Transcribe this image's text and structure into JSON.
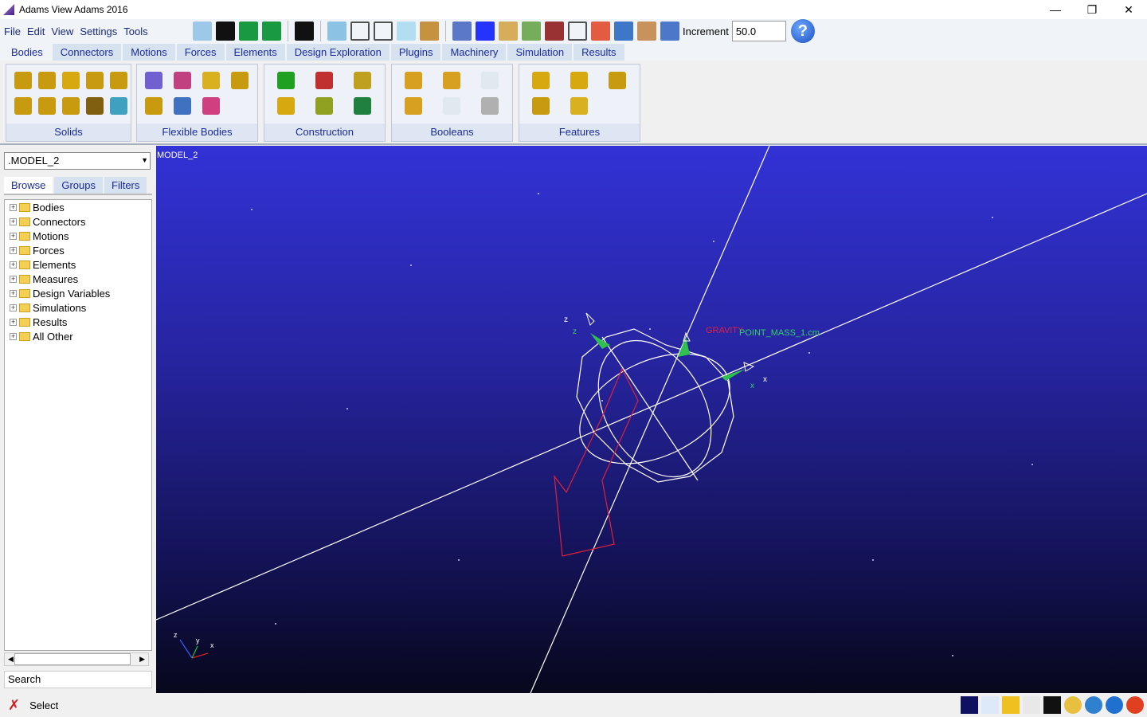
{
  "window": {
    "title": "Adams View Adams 2016",
    "min": "—",
    "max": "❐",
    "close": "✕"
  },
  "menu": [
    "File",
    "Edit",
    "View",
    "Settings",
    "Tools"
  ],
  "toolbar": {
    "increment_label": "Increment",
    "increment_value": "50.0",
    "help": "?",
    "icons": [
      "new-model-icon",
      "save-icon",
      "redo-icon",
      "undo-icon",
      "select-arrow-icon",
      "render-shaded-icon",
      "render-wireframe-icon",
      "render-hidden-icon",
      "iso-view-icon",
      "triad-icon",
      "grid-icon",
      "color-icon",
      "zoom-window-icon",
      "fit-icon",
      "fit-all-icon",
      "zoom-box-icon",
      "center-icon",
      "translate-icon",
      "pan-hand-icon",
      "zoom-icon"
    ]
  },
  "tabs": [
    "Bodies",
    "Connectors",
    "Motions",
    "Forces",
    "Elements",
    "Design Exploration",
    "Plugins",
    "Machinery",
    "Simulation",
    "Results"
  ],
  "ribbon": [
    {
      "label": "Solids",
      "icons": [
        "box-icon",
        "cylinder-icon",
        "sphere-icon",
        "frustum-icon",
        "torus-icon",
        "link-icon",
        "plate-icon",
        "extrusion-icon",
        "revolution-icon",
        "plane-icon"
      ],
      "colors": [
        "#c89a10",
        "#c89a10",
        "#d8a810",
        "#c89a10",
        "#c89a10",
        "#c89a10",
        "#c89a10",
        "#c89a10",
        "#806010",
        "#40a0c0"
      ]
    },
    {
      "label": "Flexible Bodies",
      "icons": [
        "flex-body-icon",
        "swap-flex-icon",
        "viewflex-icon",
        "beam-icon",
        "rigid-to-flex-icon",
        "flex-to-flex-icon",
        "flex-edit-icon"
      ],
      "colors": [
        "#7060d0",
        "#c04080",
        "#d8b020",
        "#c89a10",
        "#c89a10",
        "#4070c0",
        "#d04080"
      ]
    },
    {
      "label": "Construction",
      "icons": [
        "point-icon",
        "marker-icon",
        "polyline-icon",
        "arc-icon",
        "xyz-icon",
        "geometry-cg-icon"
      ],
      "colors": [
        "#20a020",
        "#c03030",
        "#c0a020",
        "#d8a810",
        "#90a020",
        "#208040"
      ]
    },
    {
      "label": "Booleans",
      "icons": [
        "union-icon",
        "merge-icon",
        "intersect-icon",
        "cut-icon",
        "split-icon",
        "chain-icon"
      ],
      "colors": [
        "#d8a020",
        "#d8a020",
        "#e0e8f0",
        "#d8a020",
        "#e0e8f0",
        "#b0b0b0"
      ]
    },
    {
      "label": "Features",
      "icons": [
        "chamfer-icon",
        "hole-icon",
        "boss-icon",
        "fillet-icon",
        "shell-icon"
      ],
      "colors": [
        "#d8a810",
        "#d8a810",
        "#c89a10",
        "#c89a10",
        "#d8b020"
      ]
    }
  ],
  "left": {
    "model": ".MODEL_2",
    "tabs": [
      "Browse",
      "Groups",
      "Filters"
    ],
    "tree": [
      "Bodies",
      "Connectors",
      "Motions",
      "Forces",
      "Elements",
      "Measures",
      "Design Variables",
      "Simulations",
      "Results",
      "All Other"
    ],
    "search": "Search"
  },
  "viewport": {
    "model_label": "MODEL_2",
    "gravity_label": "GRAVITY",
    "point_mass_label": "POINT_MASS_1.cm",
    "axis_z": "z",
    "axis_x": "x",
    "triad": {
      "z": "z",
      "y": "y",
      "x": "x"
    }
  },
  "status": {
    "mode": "Select",
    "icons": [
      "background-color-icon",
      "triad-toggle-icon",
      "color-icon",
      "grid-toggle-icon",
      "render-icon",
      "globe-icon",
      "coordinates-icon",
      "info-icon",
      "stop-icon"
    ]
  }
}
